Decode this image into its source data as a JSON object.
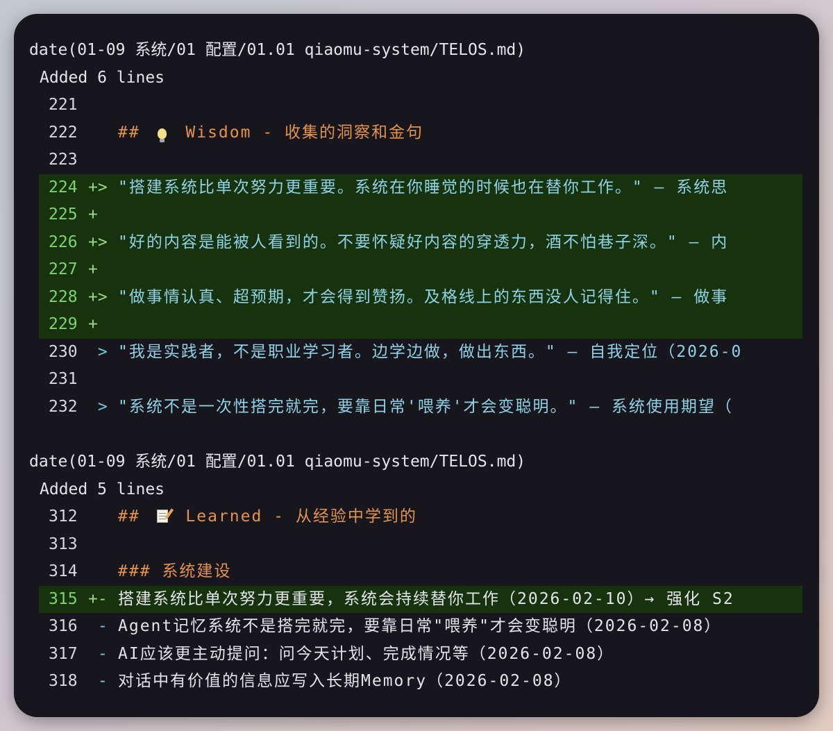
{
  "blocks": [
    {
      "command": "date(01-09 系统/01 配置/01.01 qiaomu-system/TELOS.md)",
      "summary": "Added 6 lines",
      "lines": [
        {
          "num": "221",
          "marker": "",
          "text": "",
          "kind": "context",
          "style": "text"
        },
        {
          "num": "222",
          "marker": "",
          "prefix": "## ",
          "icon": "lightbulb-icon",
          "text": " Wisdom - 收集的洞察和金句",
          "kind": "context",
          "style": "heading"
        },
        {
          "num": "223",
          "marker": "",
          "text": "",
          "kind": "context",
          "style": "text"
        },
        {
          "num": "224",
          "marker": "+>",
          "text": "\"搭建系统比单次努力更重要。系统在你睡觉的时候也在替你工作。\" — 系统思",
          "kind": "added",
          "style": "quote"
        },
        {
          "num": "225",
          "marker": "+",
          "text": "",
          "kind": "added",
          "style": "quote"
        },
        {
          "num": "226",
          "marker": "+>",
          "text": "\"好的内容是能被人看到的。不要怀疑好内容的穿透力，酒不怕巷子深。\" — 内",
          "kind": "added",
          "style": "quote"
        },
        {
          "num": "227",
          "marker": "+",
          "text": "",
          "kind": "added",
          "style": "quote"
        },
        {
          "num": "228",
          "marker": "+>",
          "text": "\"做事情认真、超预期，才会得到赞扬。及格线上的东西没人记得住。\" — 做事",
          "kind": "added",
          "style": "quote"
        },
        {
          "num": "229",
          "marker": "+",
          "text": "",
          "kind": "added",
          "style": "quote"
        },
        {
          "num": "230",
          "marker": " >",
          "text": "\"我是实践者，不是职业学习者。边学边做，做出东西。\" — 自我定位（2026-0",
          "kind": "context",
          "style": "quote"
        },
        {
          "num": "231",
          "marker": "",
          "text": "",
          "kind": "context",
          "style": "text"
        },
        {
          "num": "232",
          "marker": " >",
          "text": "\"系统不是一次性搭完就完，要靠日常'喂养'才会变聪明。\" — 系统使用期望（",
          "kind": "context",
          "style": "quote"
        }
      ]
    },
    {
      "command": "date(01-09 系统/01 配置/01.01 qiaomu-system/TELOS.md)",
      "summary": "Added 5 lines",
      "lines": [
        {
          "num": "312",
          "marker": "",
          "prefix": "## ",
          "icon": "memo-icon",
          "text": " Learned - 从经验中学到的",
          "kind": "context",
          "style": "heading"
        },
        {
          "num": "313",
          "marker": "",
          "text": "",
          "kind": "context",
          "style": "text"
        },
        {
          "num": "314",
          "marker": "",
          "text": "### 系统建设",
          "kind": "context",
          "style": "heading"
        },
        {
          "num": "315",
          "marker": "+-",
          "text": "搭建系统比单次努力更重要，系统会持续替你工作（2026-02-10）→ 强化 S2",
          "kind": "added",
          "style": "text"
        },
        {
          "num": "316",
          "marker": " -",
          "text": "Agent记忆系统不是搭完就完，要靠日常\"喂养\"才会变聪明（2026-02-08）",
          "kind": "context",
          "style": "list"
        },
        {
          "num": "317",
          "marker": " -",
          "text": "AI应该更主动提问：问今天计划、完成情况等（2026-02-08）",
          "kind": "context",
          "style": "list"
        },
        {
          "num": "318",
          "marker": " -",
          "text": "对话中有价值的信息应写入长期Memory（2026-02-08）",
          "kind": "context",
          "style": "list"
        }
      ]
    }
  ],
  "colors": {
    "window_bg": "#16161c",
    "added_bg": "#16330e",
    "heading": "#e5924f",
    "quote": "#8fd1e6",
    "added_line_number": "#7fd46c"
  }
}
